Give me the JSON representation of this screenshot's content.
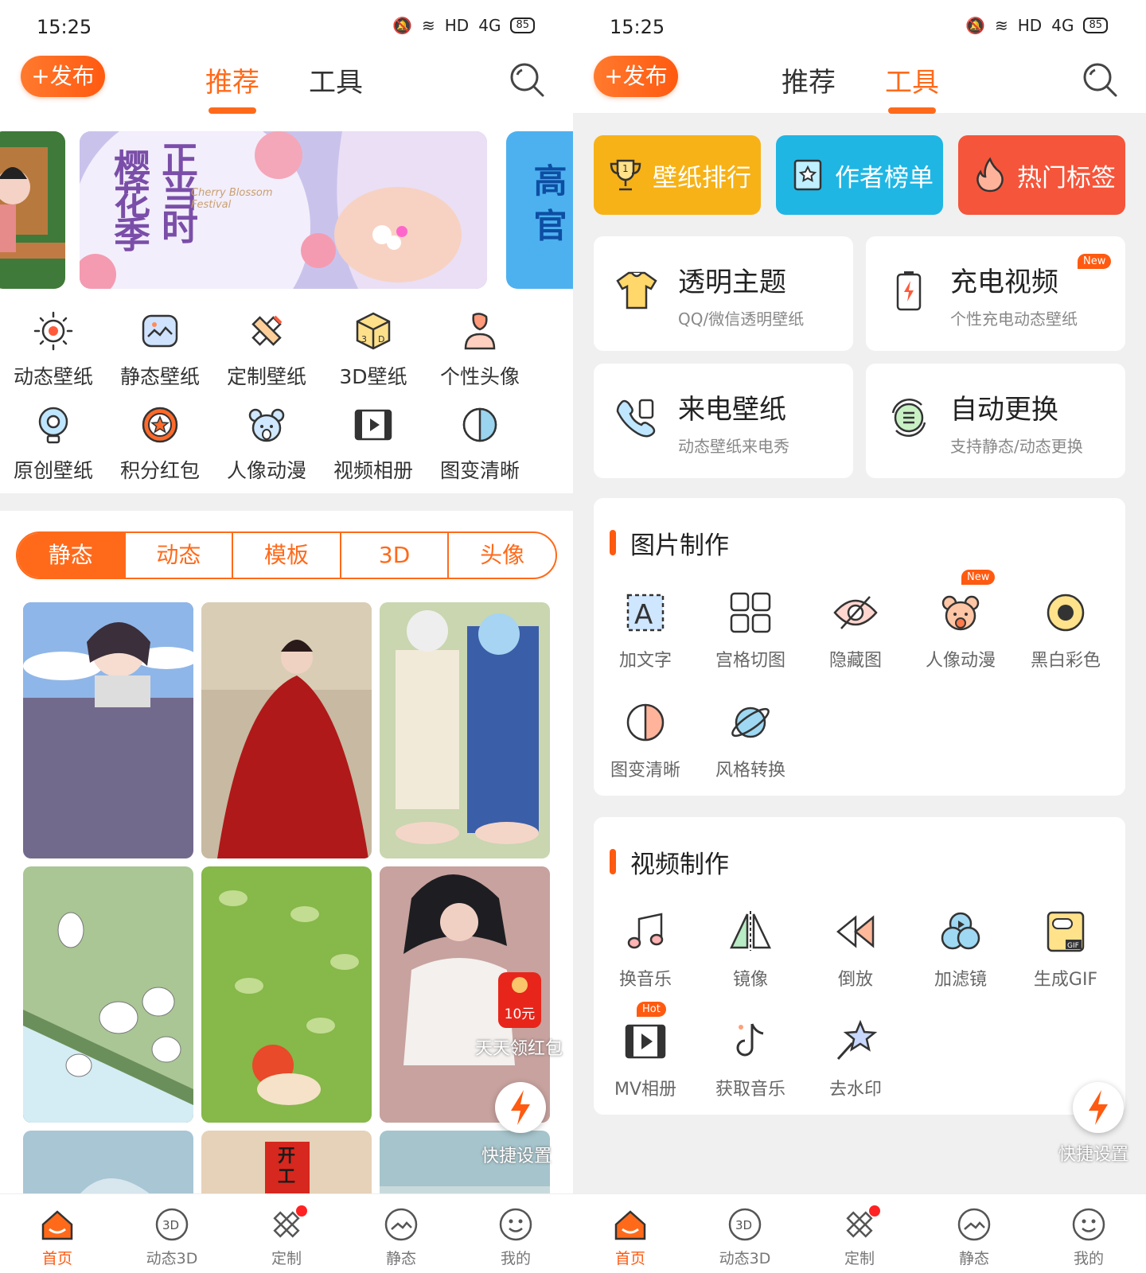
{
  "status": {
    "time": "15:25",
    "hd": "HD",
    "net": "4G",
    "battery": "85"
  },
  "header": {
    "publish": "+发布",
    "tab_recommend": "推荐",
    "tab_tools": "工具"
  },
  "left": {
    "banner": {
      "title_a": "樱花季",
      "title_b": "正当时",
      "subtitle": "Cherry Blossom Festival",
      "side_text": "高 官"
    },
    "categories": [
      {
        "label": "动态壁纸",
        "icon": "sun-icon"
      },
      {
        "label": "静态壁纸",
        "icon": "image-icon"
      },
      {
        "label": "定制壁纸",
        "icon": "pencil-ruler-icon"
      },
      {
        "label": "3D壁纸",
        "icon": "cube-3d-icon"
      },
      {
        "label": "个性头像",
        "icon": "avatar-icon"
      },
      {
        "label": "原创壁纸",
        "icon": "bulb-icon"
      },
      {
        "label": "积分红包",
        "icon": "star-coin-icon"
      },
      {
        "label": "人像动漫",
        "icon": "bear-icon"
      },
      {
        "label": "视频相册",
        "icon": "film-icon"
      },
      {
        "label": "图变清晰",
        "icon": "half-circle-icon"
      }
    ],
    "segments": [
      "静态",
      "动态",
      "模板",
      "3D",
      "头像"
    ],
    "redpacket": {
      "amount": "10元",
      "label": "天天领红包"
    },
    "quick": "快捷设置",
    "thumb_text": "开工"
  },
  "right": {
    "chips": [
      "壁纸排行",
      "作者榜单",
      "热门标签"
    ],
    "cards": [
      {
        "title": "透明主题",
        "sub": "QQ/微信透明壁纸",
        "icon": "tshirt-icon"
      },
      {
        "title": "充电视频",
        "sub": "个性充电动态壁纸",
        "icon": "battery-charge-icon",
        "badge": "New"
      },
      {
        "title": "来电壁纸",
        "sub": "动态壁纸来电秀",
        "icon": "phone-icon"
      },
      {
        "title": "自动更换",
        "sub": "支持静态/动态更换",
        "icon": "refresh-list-icon"
      }
    ],
    "photo": {
      "title": "图片制作",
      "items": [
        {
          "label": "加文字",
          "icon": "text-box-icon"
        },
        {
          "label": "宫格切图",
          "icon": "grid-icon"
        },
        {
          "label": "隐藏图",
          "icon": "eye-hidden-icon"
        },
        {
          "label": "人像动漫",
          "icon": "bear-icon",
          "badge": "New"
        },
        {
          "label": "黑白彩色",
          "icon": "color-dot-icon"
        },
        {
          "label": "图变清晰",
          "icon": "half-circle-icon"
        },
        {
          "label": "风格转换",
          "icon": "planet-icon"
        }
      ]
    },
    "video": {
      "title": "视频制作",
      "items": [
        {
          "label": "换音乐",
          "icon": "music-icon"
        },
        {
          "label": "镜像",
          "icon": "mirror-icon"
        },
        {
          "label": "倒放",
          "icon": "rewind-icon"
        },
        {
          "label": "加滤镜",
          "icon": "filter-icon"
        },
        {
          "label": "生成GIF",
          "icon": "gif-icon"
        },
        {
          "label": "MV相册",
          "icon": "film-icon",
          "badge": "Hot"
        },
        {
          "label": "获取音乐",
          "icon": "tiktok-note-icon"
        },
        {
          "label": "去水印",
          "icon": "magic-star-icon"
        }
      ]
    },
    "quick": "快捷设置"
  },
  "tabbar": [
    "首页",
    "动态3D",
    "定制",
    "静态",
    "我的"
  ],
  "colors": {
    "accent": "#ff5a10",
    "chip1": "#f7b217",
    "chip2": "#1fb6e4",
    "chip3": "#f5553a"
  }
}
